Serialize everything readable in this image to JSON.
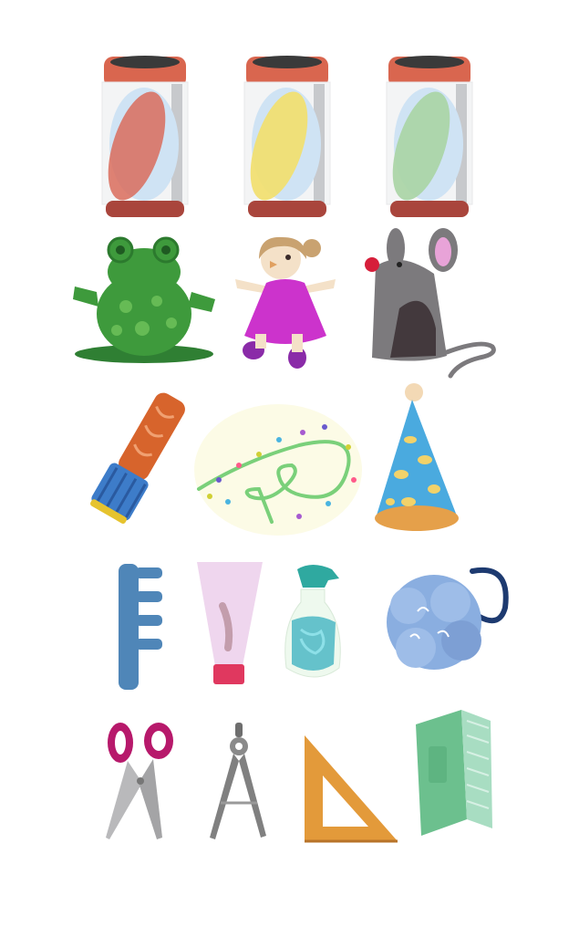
{
  "page": {
    "background": "#ffffff"
  },
  "rows": [
    {
      "row": "cans",
      "items": [
        {
          "name": "soda-can-red",
          "icon": "can-icon",
          "accent": "#d96c5c"
        },
        {
          "name": "soda-can-yellow",
          "icon": "can-icon",
          "accent": "#f2df6b"
        },
        {
          "name": "soda-can-green",
          "icon": "can-icon",
          "accent": "#a9d4a4"
        }
      ]
    },
    {
      "row": "toys",
      "items": [
        {
          "name": "frog-toy",
          "icon": "frog-icon",
          "accent": "#3e9a3c"
        },
        {
          "name": "doll-toy",
          "icon": "doll-icon",
          "accent": "#cc33cc"
        },
        {
          "name": "mouse-toy",
          "icon": "mouse-icon",
          "accent": "#7c7a7d"
        }
      ]
    },
    {
      "row": "party",
      "items": [
        {
          "name": "party-popper",
          "icon": "popper-icon",
          "accent": "#d7642c"
        },
        {
          "name": "sparkle-garland",
          "icon": "garland-icon",
          "accent": "#7ad07a"
        },
        {
          "name": "party-hat",
          "icon": "party-hat-icon",
          "accent": "#4aaadf"
        }
      ]
    },
    {
      "row": "bath",
      "items": [
        {
          "name": "comb",
          "icon": "comb-icon",
          "accent": "#4f86b8"
        },
        {
          "name": "cream-tube",
          "icon": "tube-icon",
          "accent": "#efd6ee"
        },
        {
          "name": "soap-bottle",
          "icon": "bottle-icon",
          "accent": "#4cb8c4"
        },
        {
          "name": "bath-pouf",
          "icon": "pouf-icon",
          "accent": "#8aaee0"
        }
      ]
    },
    {
      "row": "school",
      "items": [
        {
          "name": "scissors",
          "icon": "scissors-icon",
          "accent": "#b7196b"
        },
        {
          "name": "compass",
          "icon": "compass-icon",
          "accent": "#808080"
        },
        {
          "name": "set-square",
          "icon": "set-square-icon",
          "accent": "#e39a3a"
        },
        {
          "name": "book",
          "icon": "book-icon",
          "accent": "#6cc08e"
        }
      ]
    }
  ]
}
